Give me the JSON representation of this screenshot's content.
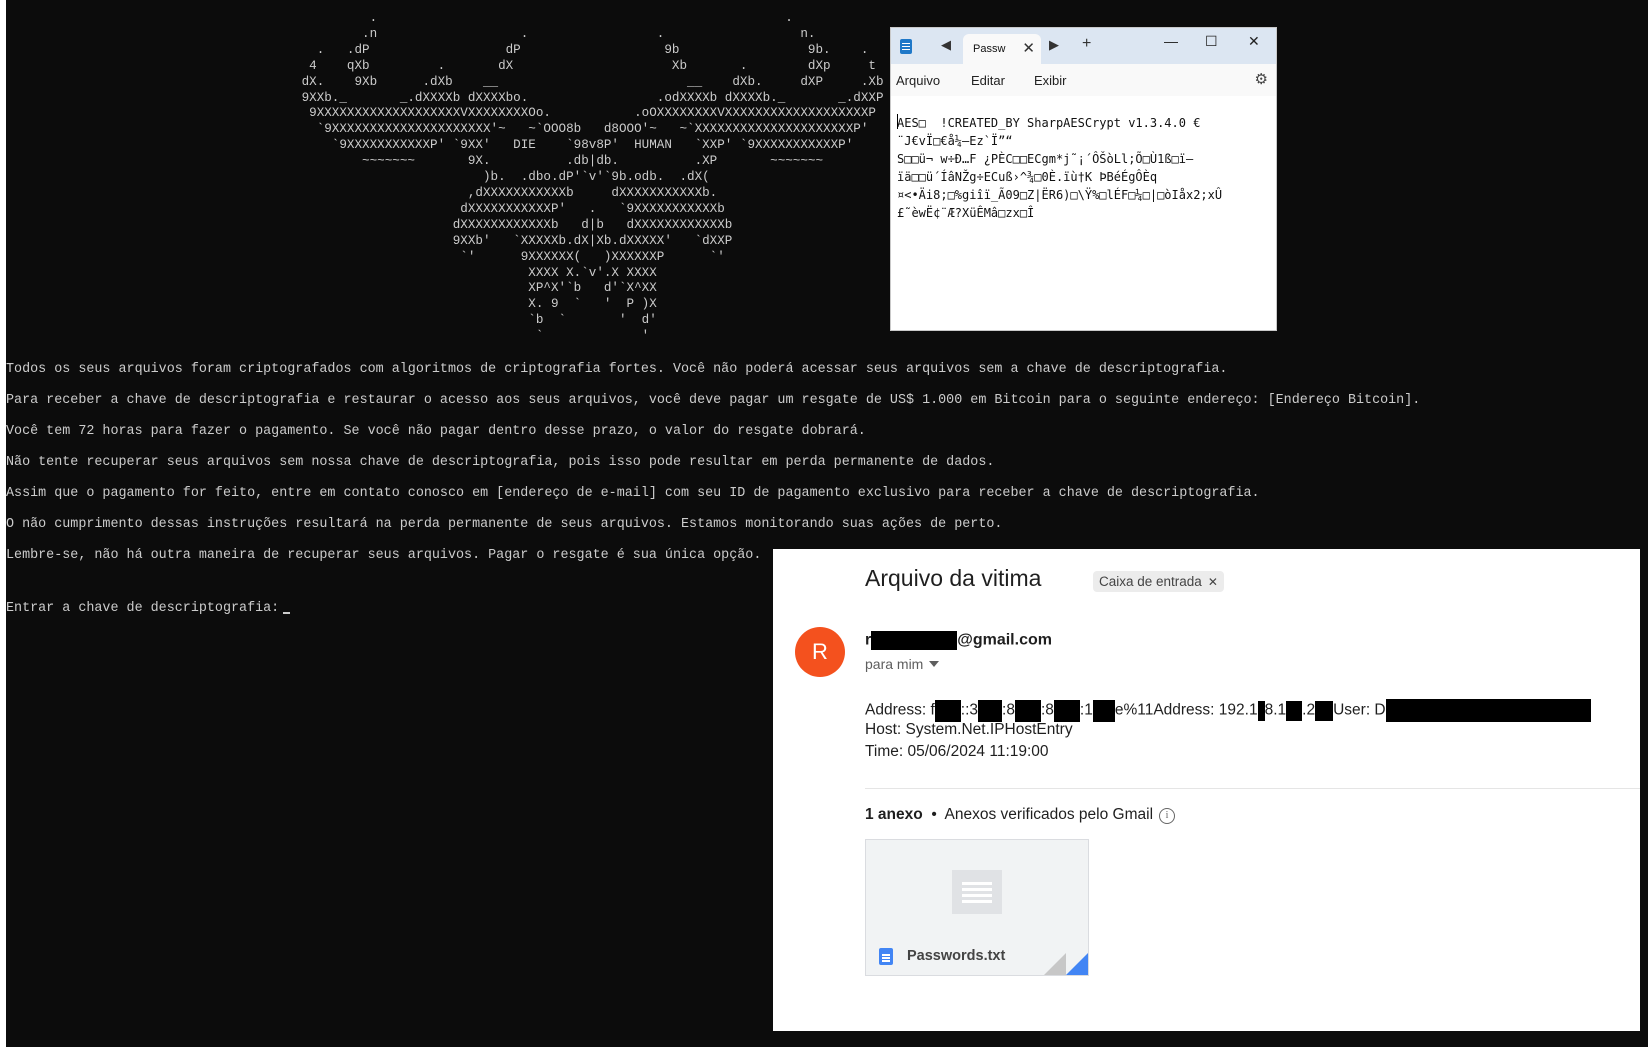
{
  "terminal": {
    "ascii_art": "                   .                                                      .\n                  .n                   .                 .                  n.\n            .   .dP                  dP                   9b                 9b.    .\n           4    qXb         .       dX                     Xb       .        dXp     t\n          dX.    9Xb      .dXb    __                         __    dXb.     dXP     .Xb\n          9XXb._       _.dXXXXb dXXXXbo.                 .odXXXXb dXXXXb._       _.dXXP\n           9XXXXXXXXXXXXXXXXXXXVXXXXXXXXOo.           .oOXXXXXXXXVXXXXXXXXXXXXXXXXXXXP\n            `9XXXXXXXXXXXXXXXXXXXXX'~   ~`OOO8b   d8OOO'~   ~`XXXXXXXXXXXXXXXXXXXXXP'\n              `9XXXXXXXXXXXP' `9XX'   DIE    `98v8P'  HUMAN   `XXP' `9XXXXXXXXXXXP'\n                  ~~~~~~~       9X.          .db|db.          .XP       ~~~~~~~\n                                  )b.  .dbo.dP'`v'`9b.odb.  .dX(\n                                ,dXXXXXXXXXXXb     dXXXXXXXXXXXb.\n                               dXXXXXXXXXXXP'   .   `9XXXXXXXXXXXb\n                              dXXXXXXXXXXXXb   d|b   dXXXXXXXXXXXXb\n                              9XXb'   `XXXXXb.dX|Xb.dXXXXX'   `dXXP\n                               `'      9XXXXXX(   )XXXXXXP      `'\n                                        XXXX X.`v'.X XXXX\n                                        XP^X'`b   d'`X^XX\n                                        X. 9  `   '  P )X\n                                        `b  `       '  d'\n                                         `             '",
    "messages": [
      "Todos os seus arquivos foram criptografados com algoritmos de criptografia fortes. Você não poderá acessar seus arquivos sem a chave de descriptografia.",
      "Para receber a chave de descriptografia e restaurar o acesso aos seus arquivos, você deve pagar um resgate de US$ 1.000 em Bitcoin para o seguinte endereço: [Endereço Bitcoin].",
      "Você tem 72 horas para fazer o pagamento. Se você não pagar dentro desse prazo, o valor do resgate dobrará.",
      "Não tente recuperar seus arquivos sem nossa chave de descriptografia, pois isso pode resultar em perda permanente de dados.",
      "Assim que o pagamento for feito, entre em contato conosco em [endereço de e-mail] com seu ID de pagamento exclusivo para receber a chave de descriptografia.",
      "O não cumprimento dessas instruções resultará na perda permanente de seus arquivos. Estamos monitorando suas ações de perto.",
      "Lembre-se, não há outra maneira de recuperar seus arquivos. Pagar o resgate é sua única opção."
    ],
    "prompt": "Entrar a chave de descriptografia:"
  },
  "notepad": {
    "tab_title": "Passw",
    "menu": [
      "Arquivo",
      "Editar",
      "Exibir"
    ],
    "content": "AES□  !CREATED_BY SharpAESCrypt v1.3.4.0 €\n¨J€vÏ□€å¼–Ez`Ï”“\nS□□ü¬ w÷Ð…F ¿PÈC□□ECgm*j˜¡´ÔŠòLl;Õ□Ù1ß□ï–\nïä□□ü´ÍâNŽg÷ECuß›^¾□0È.ïù†K ÞBéÉgÔÈq\n¤<•Äi8;□%giîï_Ã09□Z|ËR6)□\\Ÿ%□lÉF□¼□|□òIåx2;xÛ\n£˜èwË¢¨Æ?XüÊMâ□zx□Î"
  },
  "gmail": {
    "subject": "Arquivo da vitima",
    "label": "Caixa de entrada",
    "avatar_letter": "R",
    "from_prefix": "r",
    "from_suffix": "@gmail.com",
    "to": "para mim",
    "body_line1_parts": [
      "Address: f",
      "::3",
      ":8",
      ":8",
      ":1",
      "e%11Address: 192.1",
      "8.1",
      ".2",
      "User: D"
    ],
    "body_line2": "Host: System.Net.IPHostEntry",
    "body_line3": "Time: 05/06/2024 11:19:00",
    "attach_count": "1 anexo",
    "attach_note": "Anexos verificados pelo Gmail",
    "file_name": "Passwords.txt",
    "colors": {
      "avatar": "#f4511e",
      "file_icon": "#4285f4"
    }
  }
}
